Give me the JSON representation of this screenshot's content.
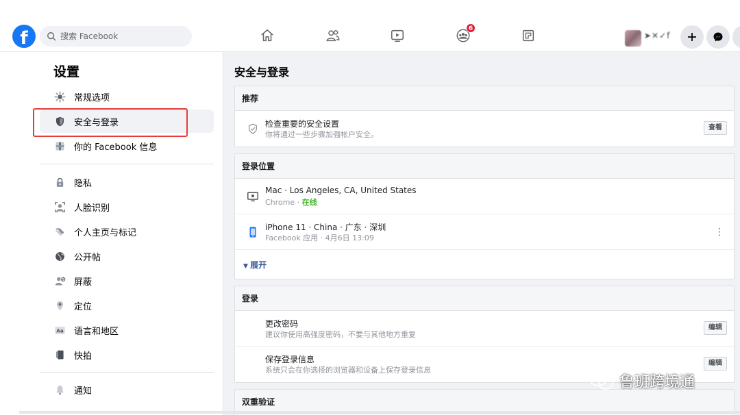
{
  "header": {
    "logo_letter": "f",
    "search_placeholder": "搜索 Facebook",
    "notification_count": "6",
    "username": "➤✕✓f"
  },
  "sidebar": {
    "title": "设置",
    "items": [
      {
        "label": "常规选项",
        "icon": "gear-icon"
      },
      {
        "label": "安全与登录",
        "icon": "shield-icon"
      },
      {
        "label": "你的 Facebook 信息",
        "icon": "facebook-info-icon"
      },
      {
        "label": "隐私",
        "icon": "lock-icon"
      },
      {
        "label": "人脸识别",
        "icon": "face-recognition-icon"
      },
      {
        "label": "个人主页与标记",
        "icon": "tag-icon"
      },
      {
        "label": "公开帖",
        "icon": "globe-icon"
      },
      {
        "label": "屏蔽",
        "icon": "block-user-icon"
      },
      {
        "label": "定位",
        "icon": "location-icon"
      },
      {
        "label": "语言和地区",
        "icon": "language-icon"
      },
      {
        "label": "快拍",
        "icon": "stories-icon"
      },
      {
        "label": "通知",
        "icon": "bell-icon"
      }
    ]
  },
  "main": {
    "title": "安全与登录",
    "recommended": {
      "header": "推荐",
      "item_title": "检查重要的安全设置",
      "item_sub": "你将通过一些步骤加强帐户安全。",
      "button": "查看"
    },
    "where_logged_in": {
      "header": "登录位置",
      "sessions": [
        {
          "title": "Mac · Los Angeles, CA, United States",
          "sub_prefix": "Chrome · ",
          "sub_status": "在线",
          "icon": "desktop-icon"
        },
        {
          "title": "iPhone 11 · China · 广东 · 深圳",
          "sub_prefix": "Facebook 应用 · 4月6日 13:09",
          "sub_status": "",
          "icon": "phone-icon"
        }
      ],
      "expand_label": "展开"
    },
    "login": {
      "header": "登录",
      "items": [
        {
          "title": "更改密码",
          "sub": "建议你使用高强度密码，不要与其他地方重复",
          "button": "编辑"
        },
        {
          "title": "保存登录信息",
          "sub": "系统只会在你选择的浏览器和设备上保存登录信息",
          "button": "编辑"
        }
      ]
    },
    "two_factor": {
      "header": "双重验证"
    }
  },
  "watermark": {
    "text": "鲁班跨境通"
  },
  "colors": {
    "brand": "#1877f2",
    "highlight": "#e63b3b",
    "online": "#42b72a",
    "badge": "#e41e3f"
  }
}
